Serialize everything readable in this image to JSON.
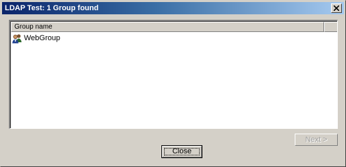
{
  "window": {
    "title": "LDAP Test: 1 Group found",
    "close_glyph": "×"
  },
  "list": {
    "columns": [
      "Group name"
    ],
    "rows": [
      {
        "icon": "group-user-icon",
        "name": "WebGroup"
      }
    ]
  },
  "buttons": {
    "next_label": "Next >",
    "next_enabled": false,
    "close_label": "Close"
  },
  "colors": {
    "title_start": "#0a246a",
    "title_end": "#a6caf0",
    "face": "#d4d0c8"
  }
}
